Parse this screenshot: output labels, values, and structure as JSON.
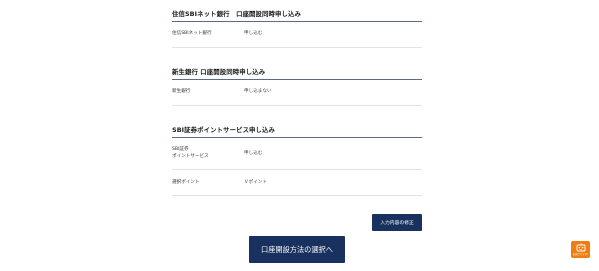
{
  "sections": {
    "sbi_bank": {
      "title": "住信SBIネット銀行　口座開設同時申し込み",
      "rows": [
        {
          "label": "住信SBIネット銀行",
          "value": "申し込む"
        }
      ]
    },
    "shinsei_bank": {
      "title": "新生銀行 口座開設同時申し込み",
      "rows": [
        {
          "label": "新生銀行",
          "value": "申し込まない"
        }
      ]
    },
    "sbi_point": {
      "title": "SBI証券ポイントサービス申し込み",
      "rows": [
        {
          "label_line1": "SBI証券",
          "label_line2": "ポイントサービス",
          "value": "申し込む"
        },
        {
          "label": "選択ポイント",
          "value": "Ｖポイント"
        }
      ]
    }
  },
  "actions": {
    "fix_input_label": "入力内容の修正",
    "next_label": "口座開設方法の選択へ"
  },
  "floating": {
    "help_label": "お困りですか?",
    "icon": "chat-robot-icon",
    "color": "#ef7d14"
  },
  "colors": {
    "primary_button": "#19315f",
    "section_rule": "#5b6a86"
  }
}
